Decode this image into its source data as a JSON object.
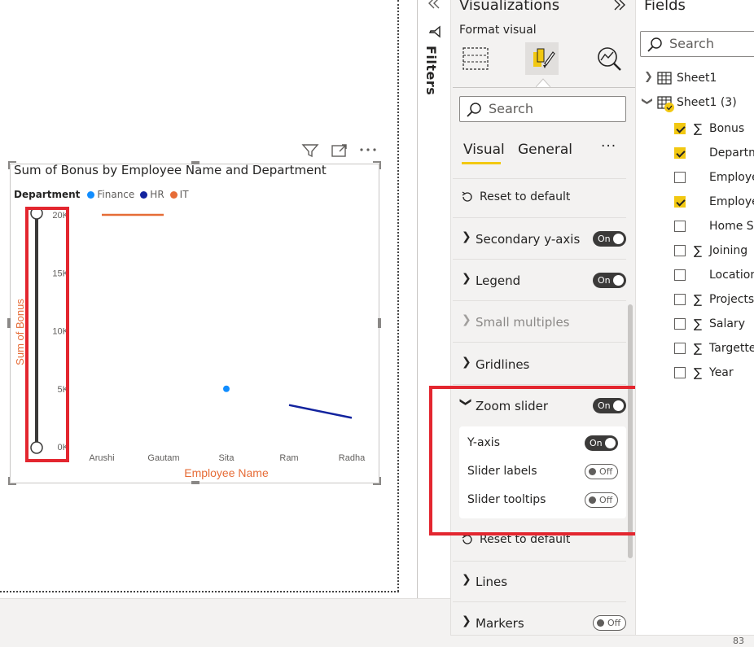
{
  "chart": {
    "title": "Sum of Bonus by Employee Name and Department",
    "legend_title": "Department",
    "legend_items": [
      {
        "label": "Finance",
        "color": "#118dff"
      },
      {
        "label": "HR",
        "color": "#12239e"
      },
      {
        "label": "IT",
        "color": "#e66c37"
      }
    ],
    "y_axis_label": "Sum of Bonus",
    "x_axis_label": "Employee Name",
    "y_ticks": [
      "20K",
      "15K",
      "10K",
      "5K",
      "0K"
    ],
    "x_categories": [
      "Arushi",
      "Gautam",
      "Sita",
      "Ram",
      "Radha"
    ]
  },
  "chart_data": {
    "type": "line",
    "categories": [
      "Arushi",
      "Gautam",
      "Sita",
      "Ram",
      "Radha"
    ],
    "series": [
      {
        "name": "Finance",
        "values": [
          null,
          null,
          5000,
          null,
          null
        ],
        "color": "#118dff"
      },
      {
        "name": "HR",
        "values": [
          null,
          null,
          null,
          3600,
          2500
        ],
        "color": "#12239e"
      },
      {
        "name": "IT",
        "values": [
          20000,
          20000,
          null,
          null,
          null
        ],
        "color": "#e66c37"
      }
    ],
    "title": "Sum of Bonus by Employee Name and Department",
    "xlabel": "Employee Name",
    "ylabel": "Sum of Bonus",
    "ylim": [
      0,
      20000
    ],
    "legend": "top-left",
    "grid": false
  },
  "filters": {
    "label": "Filters"
  },
  "viz_pane": {
    "title": "Visualizations",
    "format_visual": "Format visual",
    "search_placeholder": "Search",
    "tab_visual": "Visual",
    "tab_general": "General",
    "tab_more": "···",
    "reset_default": "Reset to default",
    "sections": [
      {
        "label": "Secondary y-axis",
        "toggle": "On"
      },
      {
        "label": "Legend",
        "toggle": "On"
      },
      {
        "label": "Small multiples",
        "toggle": ""
      },
      {
        "label": "Gridlines",
        "toggle": ""
      },
      {
        "label": "Zoom slider",
        "toggle": "On"
      },
      {
        "label": "Lines",
        "toggle": ""
      },
      {
        "label": "Markers",
        "toggle": "Off"
      }
    ],
    "zoom_options": [
      {
        "label": "Y-axis",
        "toggle": "On"
      },
      {
        "label": "Slider labels",
        "toggle": "Off"
      },
      {
        "label": "Slider tooltips",
        "toggle": "Off"
      }
    ]
  },
  "fields_pane": {
    "title": "Fields",
    "search_placeholder": "Search",
    "tables": [
      "Sheet1",
      "Sheet1 (3)"
    ],
    "fields": [
      {
        "label": "Bonus",
        "checked": true,
        "sigma": true
      },
      {
        "label": "Departm",
        "checked": true,
        "sigma": false
      },
      {
        "label": "Employe",
        "checked": false,
        "sigma": false
      },
      {
        "label": "Employe",
        "checked": true,
        "sigma": false
      },
      {
        "label": "Home S",
        "checked": false,
        "sigma": false
      },
      {
        "label": "Joining",
        "checked": false,
        "sigma": true
      },
      {
        "label": "Location",
        "checked": false,
        "sigma": false
      },
      {
        "label": "Projects",
        "checked": false,
        "sigma": true
      },
      {
        "label": "Salary",
        "checked": false,
        "sigma": true
      },
      {
        "label": "Targette",
        "checked": false,
        "sigma": true
      },
      {
        "label": "Year",
        "checked": false,
        "sigma": true
      }
    ]
  },
  "status": {
    "text": "83"
  },
  "colors": {
    "accent": "#f2c811",
    "highlight": "#e3262f",
    "axis_title": "#e66c37"
  }
}
